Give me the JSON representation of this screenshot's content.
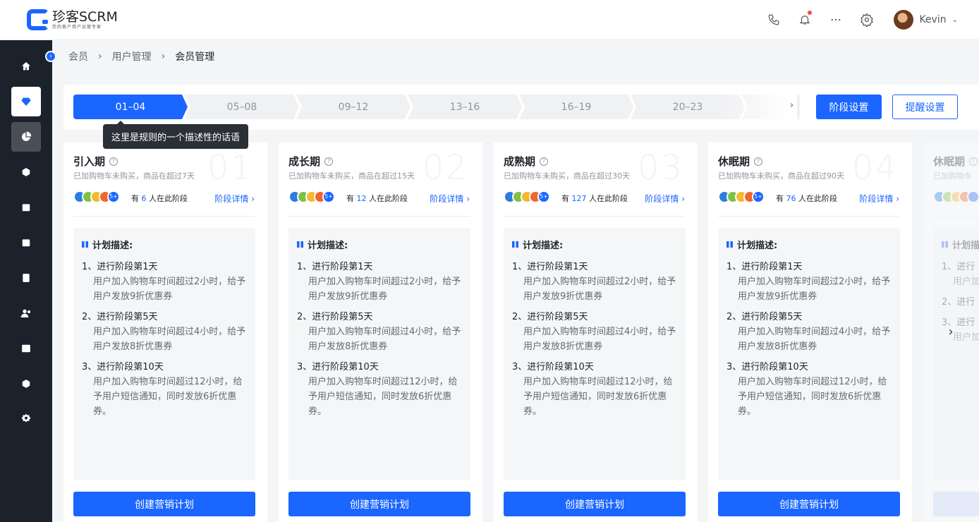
{
  "app": {
    "title": "珍客SCRM",
    "subtitle": "您的客户用户运营专家"
  },
  "user": {
    "name": "Kevin"
  },
  "breadcrumb": [
    "会员",
    "用户管理",
    "会员管理"
  ],
  "stages": [
    "01–04",
    "05–08",
    "09–12",
    "13–16",
    "16–19",
    "20–23",
    ""
  ],
  "buttons": {
    "stage_settings": "阶段设置",
    "reminder_settings": "提醒设置"
  },
  "tooltip": "这里是规则的一个描述性的话语",
  "avatar_colors": [
    "#2a7de1",
    "#7ec242",
    "#f5b82e",
    "#f0662f"
  ],
  "cards": [
    {
      "num": "01",
      "title": "引入期",
      "sub": "已加购物车未购买，商品在超过7天",
      "more": "5+",
      "count_pre": "有",
      "count": "6",
      "count_post": "人在此阶段",
      "detail": "阶段详情 ›",
      "plan_title": "计划描述:",
      "items": [
        {
          "t": "1、进行阶段第1天",
          "d": "用户加入购物车时间超过2小时，给予用户发放9折优惠券"
        },
        {
          "t": "2、进行阶段第5天",
          "d": "用户加入购物车时间超过4小时，给予用户发放8折优惠券"
        },
        {
          "t": "3、进行阶段第10天",
          "d": "用户加入购物车时间超过12小时，给予用户短信通知，同时发放6折优惠券。"
        }
      ],
      "btn": "创建营销计划"
    },
    {
      "num": "02",
      "title": "成长期",
      "sub": "已加购物车未购买，商品在超过15天",
      "more": "5+",
      "count_pre": "有",
      "count": "12",
      "count_post": "人在此阶段",
      "detail": "阶段详情 ›",
      "plan_title": "计划描述:",
      "items": [
        {
          "t": "1、进行阶段第1天",
          "d": "用户加入购物车时间超过2小时，给予用户发放9折优惠券"
        },
        {
          "t": "2、进行阶段第5天",
          "d": "用户加入购物车时间超过4小时，给予用户发放8折优惠券"
        },
        {
          "t": "3、进行阶段第10天",
          "d": "用户加入购物车时间超过12小时，给予用户短信通知，同时发放6折优惠券。"
        }
      ],
      "btn": "创建营销计划"
    },
    {
      "num": "03",
      "title": "成熟期",
      "sub": "已加购物车未购买，商品在超过30天",
      "more": "5+",
      "count_pre": "有",
      "count": "127",
      "count_post": "人在此阶段",
      "detail": "阶段详情 ›",
      "plan_title": "计划描述:",
      "items": [
        {
          "t": "1、进行阶段第1天",
          "d": "用户加入购物车时间超过2小时，给予用户发放9折优惠券"
        },
        {
          "t": "2、进行阶段第5天",
          "d": "用户加入购物车时间超过4小时，给予用户发放8折优惠券"
        },
        {
          "t": "3、进行阶段第10天",
          "d": "用户加入购物车时间超过12小时，给予用户短信通知，同时发放6折优惠券。"
        }
      ],
      "btn": "创建营销计划"
    },
    {
      "num": "04",
      "title": "休眠期",
      "sub": "已加购物车未购买，商品在超过90天",
      "more": "5+",
      "count_pre": "有",
      "count": "76",
      "count_post": "人在此阶段",
      "detail": "阶段详情 ›",
      "plan_title": "计划描述:",
      "items": [
        {
          "t": "1、进行阶段第1天",
          "d": "用户加入购物车时间超过2小时，给予用户发放9折优惠券"
        },
        {
          "t": "2、进行阶段第5天",
          "d": "用户加入购物车时间超过4小时，给予用户发放8折优惠券"
        },
        {
          "t": "3、进行阶段第10天",
          "d": "用户加入购物车时间超过12小时，给予用户短信通知，同时发放6折优惠券。"
        }
      ],
      "btn": "创建营销计划"
    },
    {
      "num": "",
      "title": "休眠期",
      "sub": "已加购物车",
      "more": "",
      "count_pre": "",
      "count": "",
      "count_post": "",
      "detail": "",
      "plan_title": "计划描",
      "items": [
        {
          "t": "1、进行",
          "d": "用户加 卡期户"
        },
        {
          "t": "2、进行",
          "d": ""
        },
        {
          "t": "3、进行",
          "d": "用户加 卡期户 券。"
        }
      ],
      "btn": ""
    }
  ],
  "icons": {
    "phone": "phone-icon",
    "bell": "bell-icon",
    "more": "more-icon",
    "gear": "gear-icon",
    "sidebar": [
      "home-icon",
      "diamond-icon",
      "pie-chart-icon",
      "cube-icon",
      "box-icon",
      "calendar-icon",
      "document-icon",
      "users-icon",
      "trend-icon",
      "shield-icon",
      "settings-icon"
    ]
  }
}
